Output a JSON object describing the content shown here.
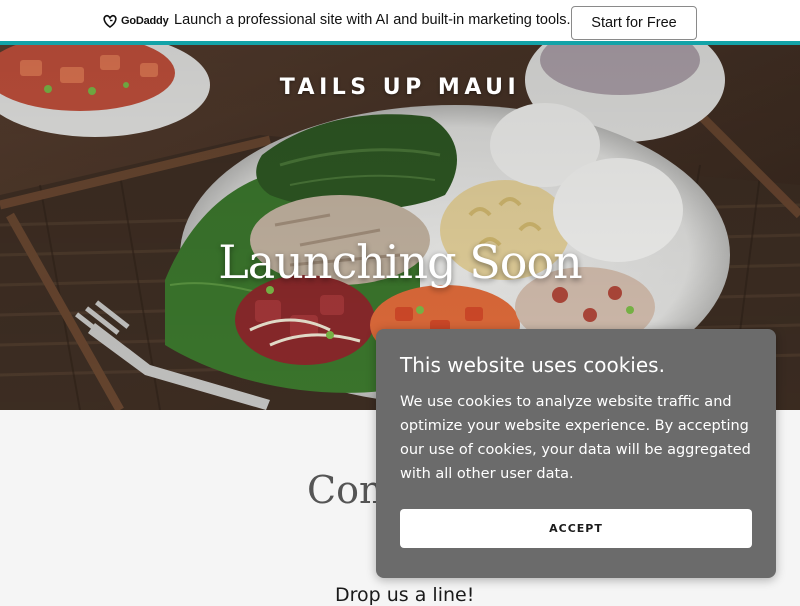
{
  "promo_bar": {
    "logo_text": "GoDaddy",
    "message": "Launch a professional site with AI and built-in marketing tools.",
    "cta_label": "Start for Free",
    "accent_color": "#13a3a8"
  },
  "hero": {
    "site_title": "TAILS UP MAUI",
    "heading": "Launching Soon"
  },
  "contact": {
    "heading": "Con",
    "subheading": "Drop us a line!"
  },
  "cookie_dialog": {
    "title": "This website uses cookies.",
    "body": "We use cookies to analyze website traffic and optimize your website experience. By accepting our use of cookies, your data will be aggregated with all other user data.",
    "accept_label": "ACCEPT",
    "background_color": "#6b6b6b"
  }
}
